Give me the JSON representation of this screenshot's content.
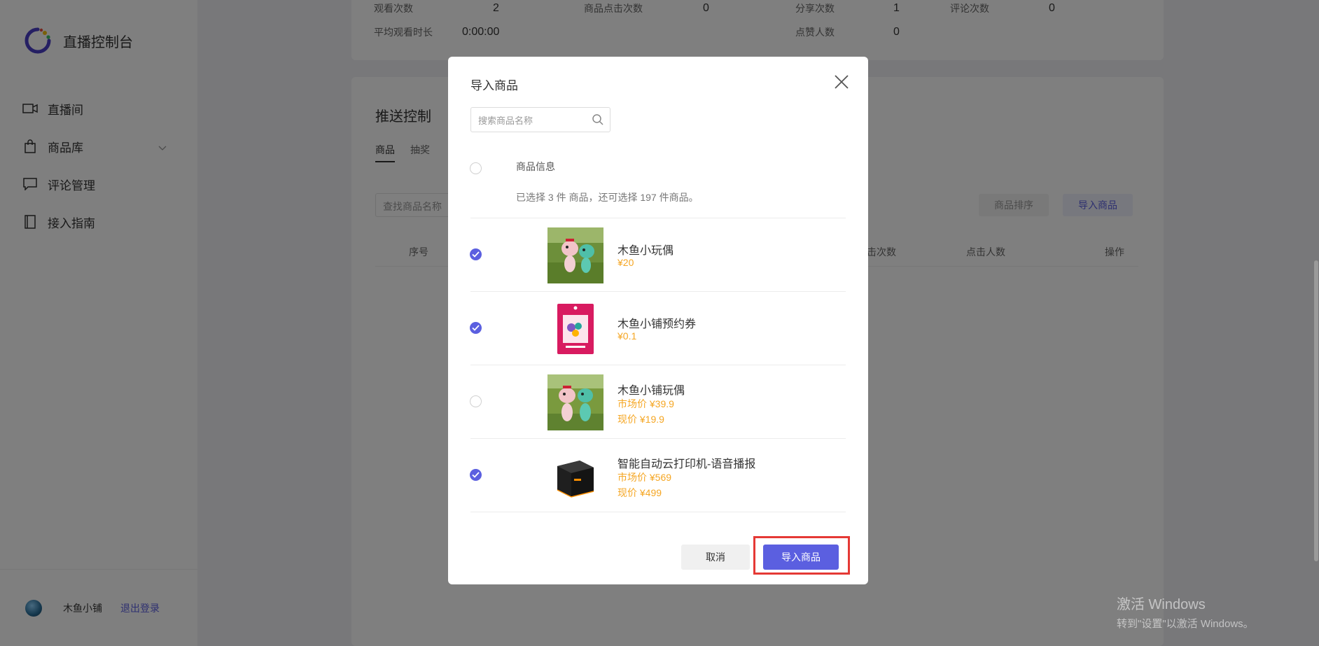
{
  "app": {
    "title": "直播控制台",
    "brand_color": "#5b5fe0"
  },
  "sidebar": {
    "items": [
      {
        "label": "直播间",
        "icon": "video-camera-icon"
      },
      {
        "label": "商品库",
        "icon": "shopping-bag-icon",
        "expandable": true
      },
      {
        "label": "评论管理",
        "icon": "comment-icon"
      },
      {
        "label": "接入指南",
        "icon": "book-icon"
      }
    ],
    "footer": {
      "shop_name": "木鱼小铺",
      "logout_label": "退出登录"
    }
  },
  "stats": {
    "row1": [
      {
        "label": "观看次数",
        "value": "2"
      },
      {
        "label": "商品点击次数",
        "value": "0"
      },
      {
        "label": "分享次数",
        "value": "1"
      },
      {
        "label": "评论次数",
        "value": "0"
      }
    ],
    "row2": [
      {
        "label": "平均观看时长",
        "value": "0:00:00"
      },
      {
        "label": "点赞人数",
        "value": "0"
      }
    ]
  },
  "push": {
    "title": "推送控制",
    "tabs": [
      "商品",
      "抽奖"
    ],
    "search_placeholder": "查找商品名称",
    "sort_button": "商品排序",
    "import_button": "导入商品",
    "columns": [
      "序号",
      "击次数",
      "点击人数",
      "操作"
    ]
  },
  "modal": {
    "title": "导入商品",
    "search_placeholder": "搜索商品名称",
    "header_label": "商品信息",
    "selection_note": "已选择 3 件 商品，还可选择 197 件商品。",
    "products": [
      {
        "name": "木鱼小玩偶",
        "prices": [
          "¥20"
        ],
        "checked": true,
        "thumb": "plush-toys-image"
      },
      {
        "name": "木鱼小铺预约券",
        "prices": [
          "¥0.1"
        ],
        "checked": true,
        "thumb": "coupon-image"
      },
      {
        "name": "木鱼小铺玩偶",
        "prices": [
          "市场价 ¥39.9",
          "现价 ¥19.9"
        ],
        "checked": false,
        "thumb": "plush-toys-image"
      },
      {
        "name": "智能自动云打印机-语音播报",
        "prices": [
          "市场价 ¥569",
          "现价 ¥499"
        ],
        "checked": true,
        "thumb": "printer-image"
      }
    ],
    "cancel_label": "取消",
    "confirm_label": "导入商品"
  },
  "watermark": {
    "line1": "激活 Windows",
    "line2": "转到\"设置\"以激活 Windows。"
  }
}
